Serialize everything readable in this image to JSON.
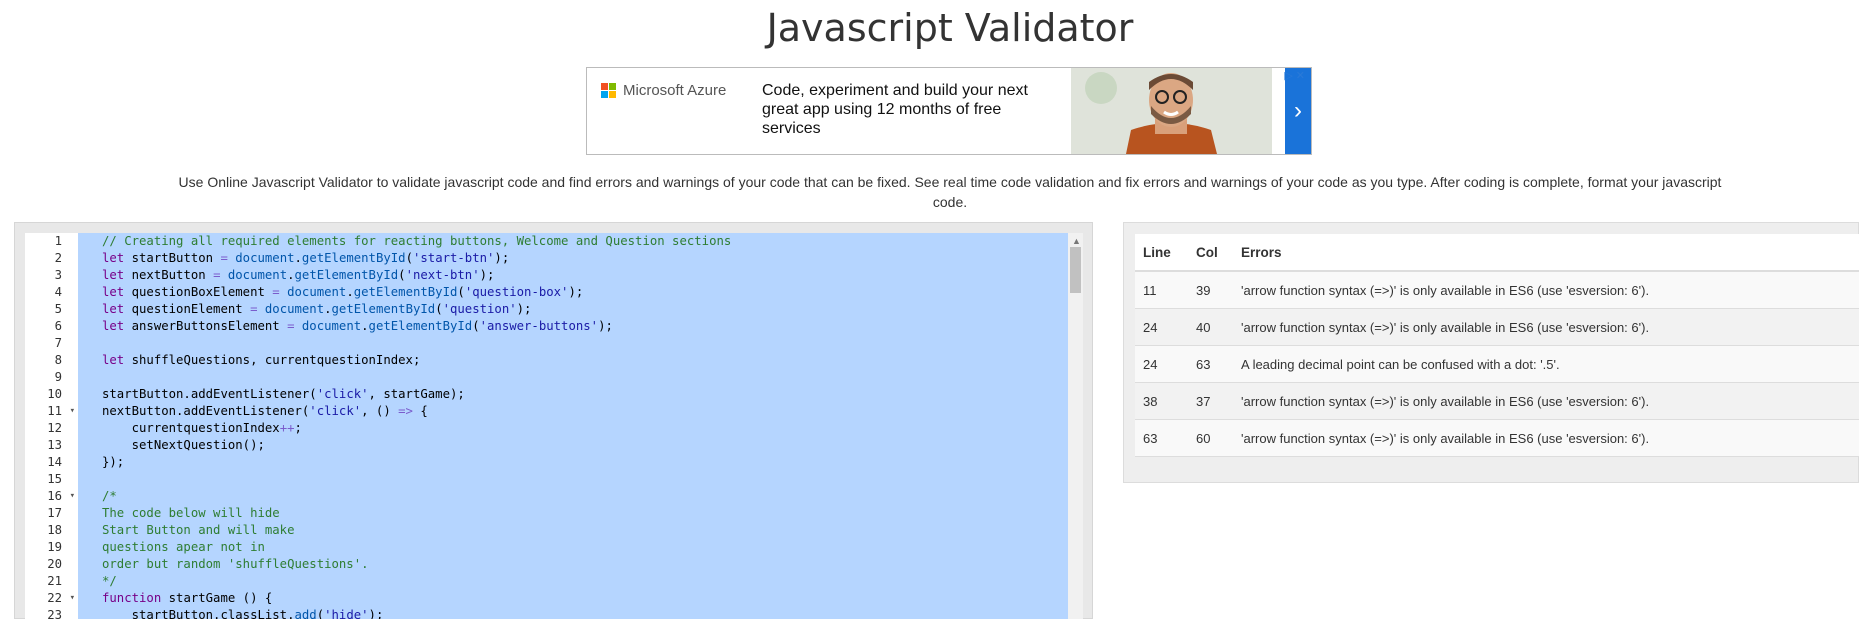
{
  "page": {
    "title": "Javascript Validator",
    "description": "Use Online Javascript Validator to validate javascript code and find errors and warnings of your code that can be fixed. See real time code validation and fix errors and warnings of your code as you type. After coding is complete, format your javascript code."
  },
  "ad": {
    "brand": "Microsoft Azure",
    "copy": "Code, experiment and build your next great app using 12 months of free services",
    "arrow_icon": "chevron-right-icon",
    "colors": {
      "arrow_bg": "#1a73d9"
    }
  },
  "editor": {
    "line_numbers": [
      "1",
      "2",
      "3",
      "4",
      "5",
      "6",
      "7",
      "8",
      "9",
      "10",
      "11",
      "12",
      "13",
      "14",
      "15",
      "16",
      "17",
      "18",
      "19",
      "20",
      "21",
      "22",
      "23"
    ],
    "fold_markers": [
      "11",
      "16",
      "22"
    ],
    "lines": [
      "// Creating all required elements for reacting buttons, Welcome and Question sections",
      "let startButton = document.getElementById('start-btn');",
      "let nextButton = document.getElementById('next-btn');",
      "let questionBoxElement = document.getElementById('question-box');",
      "let questionElement = document.getElementById('question');",
      "let answerButtonsElement = document.getElementById('answer-buttons');",
      "",
      "let shuffleQuestions, currentquestionIndex;",
      "",
      "startButton.addEventListener('click', startGame);",
      "nextButton.addEventListener('click', () => {",
      "    currentquestionIndex++;",
      "    setNextQuestion();",
      "});",
      "",
      "/*",
      "The code below will hide",
      "Start Button and will make",
      "questions apear not in",
      "order but random 'shuffleQuestions'.",
      "*/",
      "function startGame () {",
      "    startButton.classList.add('hide');"
    ],
    "colors": {
      "selection": "#b5d5ff"
    }
  },
  "errors": {
    "headers": {
      "line": "Line",
      "col": "Col",
      "errors": "Errors"
    },
    "rows": [
      {
        "line": "11",
        "col": "39",
        "message": "'arrow function syntax (=>)' is only available in ES6 (use 'esversion: 6')."
      },
      {
        "line": "24",
        "col": "40",
        "message": "'arrow function syntax (=>)' is only available in ES6 (use 'esversion: 6')."
      },
      {
        "line": "24",
        "col": "63",
        "message": "A leading decimal point can be confused with a dot: '.5'."
      },
      {
        "line": "38",
        "col": "37",
        "message": "'arrow function syntax (=>)' is only available in ES6 (use 'esversion: 6')."
      },
      {
        "line": "63",
        "col": "60",
        "message": "'arrow function syntax (=>)' is only available in ES6 (use 'esversion: 6')."
      }
    ]
  }
}
